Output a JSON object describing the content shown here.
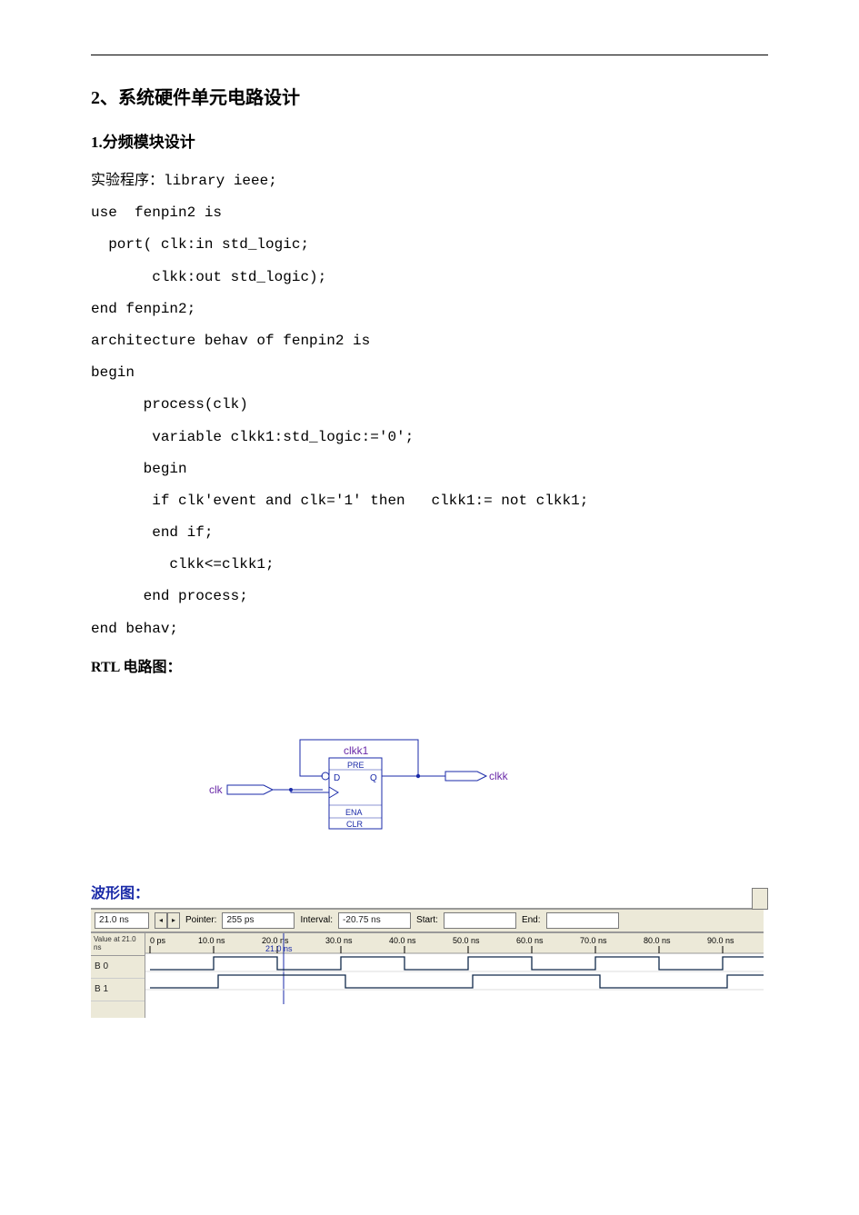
{
  "heading2": "2、系统硬件单元电路设计",
  "heading3": "1.分频模块设计",
  "code_prefix_cn": "实验程序：",
  "code": {
    "l1": "library ieee;",
    "l2": "use  fenpin2 is",
    "l3": "  port( clk:in std_logic;",
    "l4": "       clkk:out std_logic);",
    "l5": "end fenpin2;",
    "l6": "architecture behav of fenpin2 is",
    "l7": "begin",
    "l8": "      process(clk)",
    "l9": "       variable clkk1:std_logic:='0';",
    "l10": "      begin",
    "l11": "       if clk'event and clk='1' then   clkk1:= not clkk1;",
    "l12": "       end if;",
    "l13": "         clkk<=clkk1;",
    "l14": "      end process;",
    "l15": "end behav;"
  },
  "rtl_label": "RTL 电路图：",
  "rtl": {
    "in_port": "clk",
    "block_name": "clkk1",
    "pin_pre": "PRE",
    "pin_d": "D",
    "pin_q": "Q",
    "pin_ena": "ENA",
    "pin_clr": "CLR",
    "out_port": "clkk"
  },
  "wave_label": "波形图：",
  "wave": {
    "time_field": "21.0 ns",
    "pointer_lbl": "Pointer:",
    "pointer_val": "255 ps",
    "interval_lbl": "Interval:",
    "interval_val": "-20.75 ns",
    "start_lbl": "Start:",
    "start_val": "",
    "end_lbl": "End:",
    "end_val": "",
    "left_header": "Value at\n21.0 ns",
    "sig1": "B 0",
    "sig2": "B 1",
    "ticks": [
      "0 ps",
      "10.0 ns",
      "20.0 ns",
      "30.0 ns",
      "40.0 ns",
      "50.0 ns",
      "60.0 ns",
      "70.0 ns",
      "80.0 ns",
      "90.0 ns"
    ],
    "cursor_label": "21.0 ns"
  }
}
